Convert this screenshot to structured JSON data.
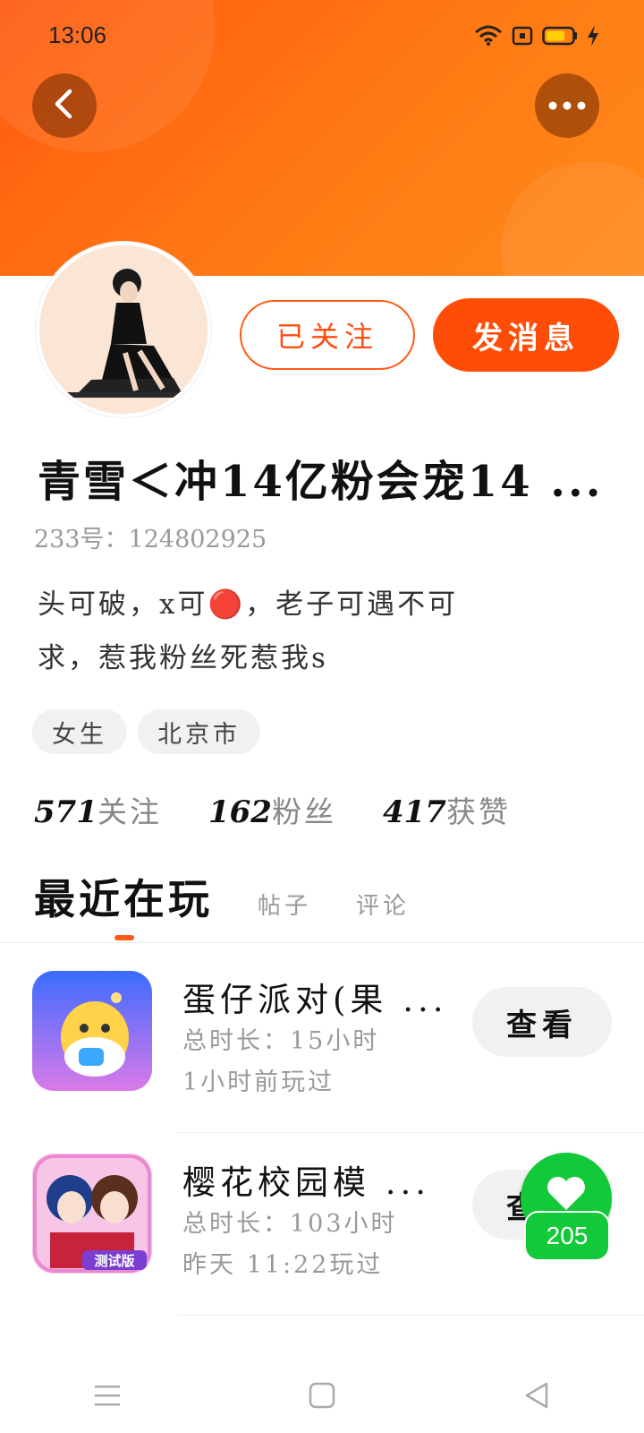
{
  "status_bar": {
    "time": "13:06",
    "icons": [
      "wifi-icon",
      "sim-icon",
      "battery-icon",
      "charging-icon"
    ]
  },
  "header": {
    "back_icon": "chevron-left-icon",
    "more_icon": "ellipsis-icon",
    "gradient_colors": [
      "#ff5a0f",
      "#ff8a1c"
    ]
  },
  "profile": {
    "follow_label": "已关注",
    "message_label": "发消息",
    "username": "青雪＜冲14亿粉会宠14 ...",
    "account_id": "233号：124802925",
    "bio_line1": "头可破，x可🔴，老子可遇不可",
    "bio_line2": "求，惹我粉丝死惹我s",
    "tags": [
      "女生",
      "北京市"
    ],
    "stats": {
      "following_count": "571",
      "following_label": "关注",
      "fans_count": "162",
      "fans_label": "粉丝",
      "likes_count": "417",
      "likes_label": "获赞"
    }
  },
  "tabs": {
    "active": "最近在玩",
    "posts": "帖子",
    "comments": "评论"
  },
  "games": [
    {
      "title": "蛋仔派对(果 ...",
      "duration": "总时长：15小时",
      "last_played": "1小时前玩过",
      "button": "查看"
    },
    {
      "title": "樱花校园模 ...",
      "duration": "总时长：103小时",
      "last_played": "昨天 11:22玩过",
      "button": "查看"
    }
  ],
  "like_widget": {
    "count": "205",
    "icon": "heart-icon",
    "color": "#12c93a"
  },
  "accent_color": "#ff4d08",
  "game2_icon_badge": "测试版",
  "nav_bar": {
    "icons": [
      "menu-icon",
      "home-square-icon",
      "back-triangle-icon"
    ]
  }
}
